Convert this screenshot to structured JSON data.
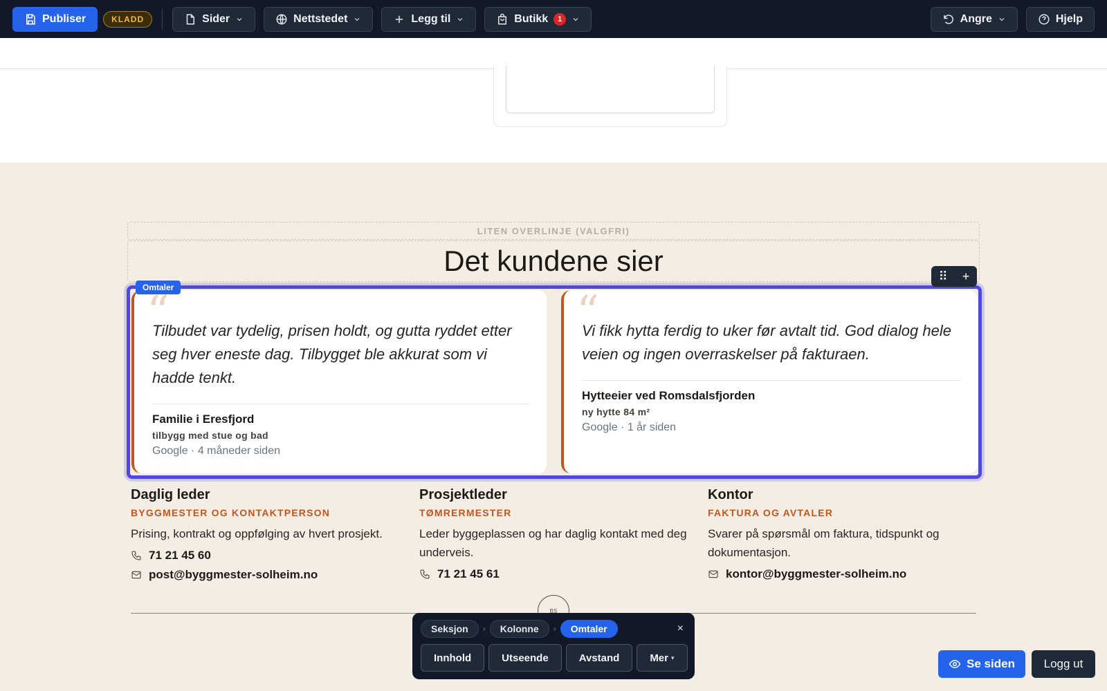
{
  "toolbar": {
    "publish_label": "Publiser",
    "status_badge": "KLADD",
    "pages_label": "Sider",
    "site_label": "Nettstedet",
    "add_label": "Legg til",
    "shop_label": "Butikk",
    "shop_count": "1",
    "undo_label": "Angre",
    "help_label": "Hjelp"
  },
  "section": {
    "overline_placeholder": "LITEN OVERLINJE (VALGFRI)",
    "heading": "Det kundene sier",
    "selected_block_tag": "Omtaler"
  },
  "testimonials": [
    {
      "quote": "Tilbudet var tydelig, prisen holdt, og gutta ryddet etter seg hver eneste dag. Tilbygget ble akkurat som vi hadde tenkt.",
      "author": "Familie i Eresfjord",
      "project": "tilbygg med stue og bad",
      "source": "Google · 4 måneder siden"
    },
    {
      "quote": "Vi fikk hytta ferdig to uker før avtalt tid. God dialog hele veien og ingen overraskelser på fakturaen.",
      "author": "Hytteeier ved Romsdalsfjorden",
      "project": "ny hytte 84 m²",
      "source": "Google · 1 år siden"
    }
  ],
  "contacts": [
    {
      "title": "Daglig leder",
      "role": "BYGGMESTER OG KONTAKTPERSON",
      "description": "Prising, kontrakt og oppfølging av hvert prosjekt.",
      "phone": "71 21 45 60",
      "email": "post@byggmester-solheim.no"
    },
    {
      "title": "Prosjektleder",
      "role": "TØMRERMESTER",
      "description": "Leder byggeplassen og har daglig kontakt med deg underveis.",
      "phone": "71 21 45 61"
    },
    {
      "title": "Kontor",
      "role": "FAKTURA OG AVTALER",
      "description": "Svarer på spørsmål om faktura, tidspunkt og dokumentasjon.",
      "email": "kontor@byggmester-solheim.no"
    }
  ],
  "logo_initials": "BS",
  "editor": {
    "breadcrumbs": [
      "Seksjon",
      "Kolonne",
      "Omtaler"
    ],
    "close_symbol": "×",
    "tabs": [
      "Innhold",
      "Utseende",
      "Avstand",
      "Mer"
    ]
  },
  "footer_actions": {
    "see_page": "Se siden",
    "logout": "Logg ut"
  },
  "colors": {
    "accent": "#2563eb",
    "selection": "#4f46e5",
    "brand_orange": "#c2561e",
    "section_bg": "#f4ede4",
    "toolbar_bg": "#111827"
  }
}
